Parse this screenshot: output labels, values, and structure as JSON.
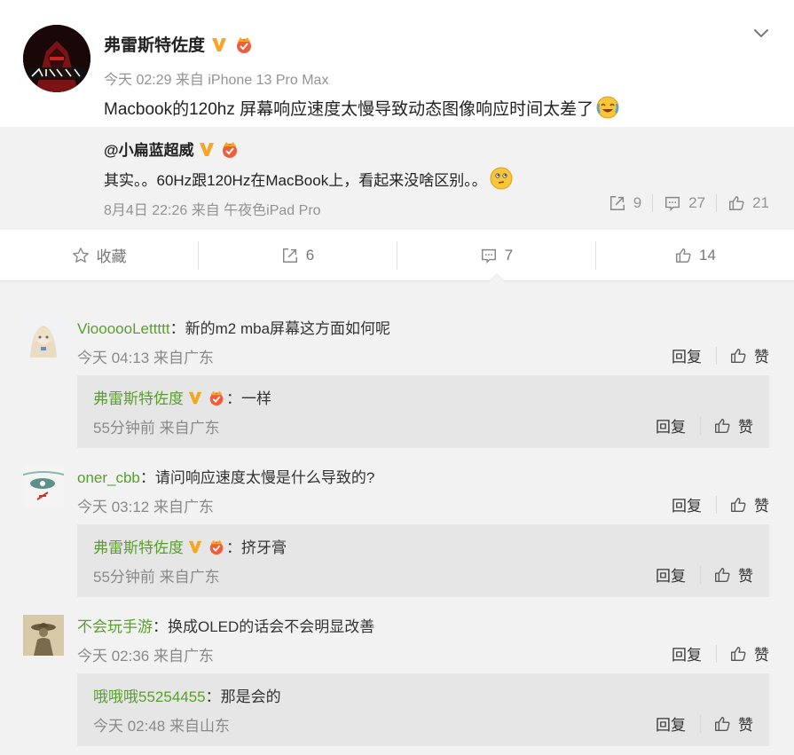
{
  "post": {
    "username": "弗雷斯特佐度",
    "meta": "今天 02:29 来自 iPhone 13 Pro Max",
    "text": "Macbook的120hz 屏幕响应速度太慢导致动态图像响应时间太差了"
  },
  "repost": {
    "username": "@小扁蓝超威",
    "text": "其实。。60Hz跟120Hz在MacBook上，看起来没啥区别。。",
    "meta": "8月4日 22:26 来自 午夜色iPad Pro",
    "shares": "9",
    "comments": "27",
    "likes": "21"
  },
  "actions": {
    "favorite_label": "收藏",
    "share_count": "6",
    "comment_count": "7",
    "like_count": "14"
  },
  "comments": [
    {
      "name": "VioooooLettttt",
      "text": "：新的m2 mba屏幕这方面如何呢",
      "meta": "今天 04:13 来自广东",
      "reply": {
        "name": "弗雷斯特佐度",
        "text": "：一样",
        "meta": "55分钟前 来自广东"
      }
    },
    {
      "name": "oner_cbb",
      "text": "：请问响应速度太慢是什么导致的?",
      "meta": "今天 03:12 来自广东",
      "reply": {
        "name": "弗雷斯特佐度",
        "text": "：挤牙膏",
        "meta": "55分钟前 来自广东"
      }
    },
    {
      "name": "不会玩手游",
      "text": "：换成OLED的话会不会明显改善",
      "meta": "今天 02:36 来自广东",
      "reply": {
        "name": "哦哦哦55254455",
        "text": "：那是会的",
        "meta": "今天 02:48 来自山东"
      }
    }
  ],
  "labels": {
    "reply": "回复",
    "like": "赞"
  },
  "colors": {
    "accent_green": "#5a9e2e",
    "verified_gold": "#f5a623",
    "background_gray": "#f2f2f2"
  }
}
